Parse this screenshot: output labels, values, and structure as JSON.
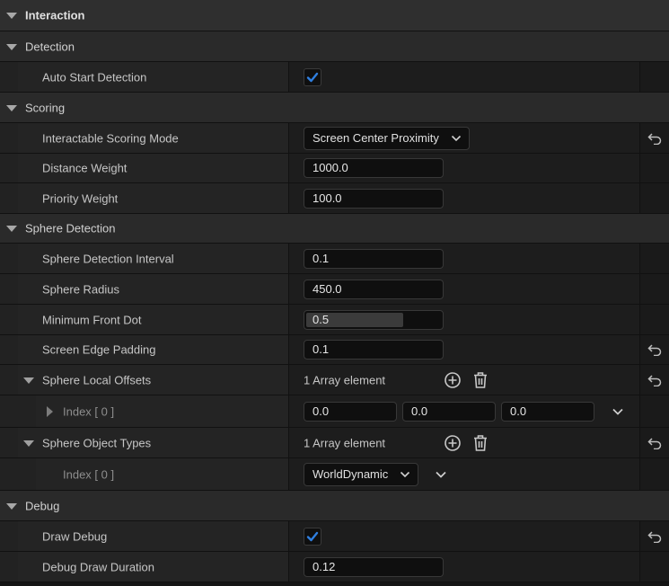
{
  "categories": {
    "interaction": "Interaction",
    "detection": "Detection",
    "scoring": "Scoring",
    "sphere_detection": "Sphere Detection",
    "debug": "Debug"
  },
  "props": {
    "auto_start_detection": {
      "label": "Auto Start Detection",
      "checked": true
    },
    "scoring_mode": {
      "label": "Interactable Scoring Mode",
      "value": "Screen Center Proximity"
    },
    "distance_weight": {
      "label": "Distance Weight",
      "value": "1000.0"
    },
    "priority_weight": {
      "label": "Priority Weight",
      "value": "100.0"
    },
    "sphere_interval": {
      "label": "Sphere Detection Interval",
      "value": "0.1"
    },
    "sphere_radius": {
      "label": "Sphere Radius",
      "value": "450.0"
    },
    "min_front_dot": {
      "label": "Minimum Front Dot",
      "value": "0.5",
      "fill_fraction": 0.73
    },
    "screen_edge_padding": {
      "label": "Screen Edge Padding",
      "value": "0.1"
    },
    "sphere_local_offsets": {
      "label": "Sphere Local Offsets",
      "summary": "1 Array element",
      "index_label": "Index [ 0 ]",
      "x": "0.0",
      "y": "0.0",
      "z": "0.0"
    },
    "sphere_object_types": {
      "label": "Sphere Object Types",
      "summary": "1 Array element",
      "index_label": "Index [ 0 ]",
      "value": "WorldDynamic"
    },
    "draw_debug": {
      "label": "Draw Debug",
      "checked": true
    },
    "debug_draw_duration": {
      "label": "Debug Draw Duration",
      "value": "0.12"
    }
  },
  "colors": {
    "check_blue": "#2f7fe0",
    "background": "#151515"
  }
}
